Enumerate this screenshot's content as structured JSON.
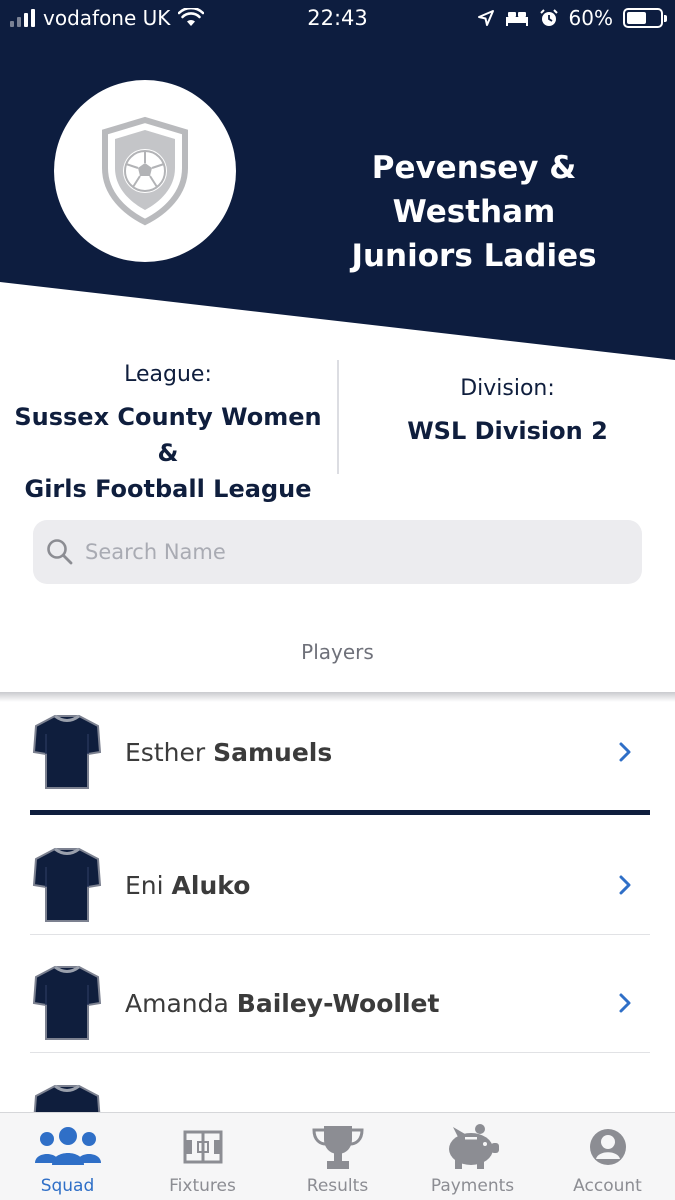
{
  "status_bar": {
    "carrier": "vodafone UK",
    "time": "22:43",
    "battery_percent": "60%",
    "battery_level": 0.6
  },
  "header": {
    "team_name_line1": "Pevensey & Westham",
    "team_name_line2": "Juniors Ladies"
  },
  "info": {
    "league_label": "League:",
    "league_line1": "Sussex County Women &",
    "league_line2": "Girls Football League",
    "division_label": "Division:",
    "division_value": "WSL Division 2"
  },
  "search": {
    "placeholder": "Search Name",
    "value": ""
  },
  "section_label": "Players",
  "players": [
    {
      "first": "Esther",
      "last": "Samuels"
    },
    {
      "first": "Eni",
      "last": "Aluko"
    },
    {
      "first": "Amanda",
      "last": "Bailey-Woollet"
    }
  ],
  "tabs": [
    {
      "label": "Squad",
      "icon": "people-icon",
      "active": true
    },
    {
      "label": "Fixtures",
      "icon": "pitch-icon",
      "active": false
    },
    {
      "label": "Results",
      "icon": "trophy-icon",
      "active": false
    },
    {
      "label": "Payments",
      "icon": "piggy-bank-icon",
      "active": false
    },
    {
      "label": "Account",
      "icon": "user-icon",
      "active": false
    }
  ],
  "colors": {
    "navy": "#0f1e3d",
    "accent_blue": "#2f6fc7",
    "tab_inactive": "#8c8d93"
  }
}
